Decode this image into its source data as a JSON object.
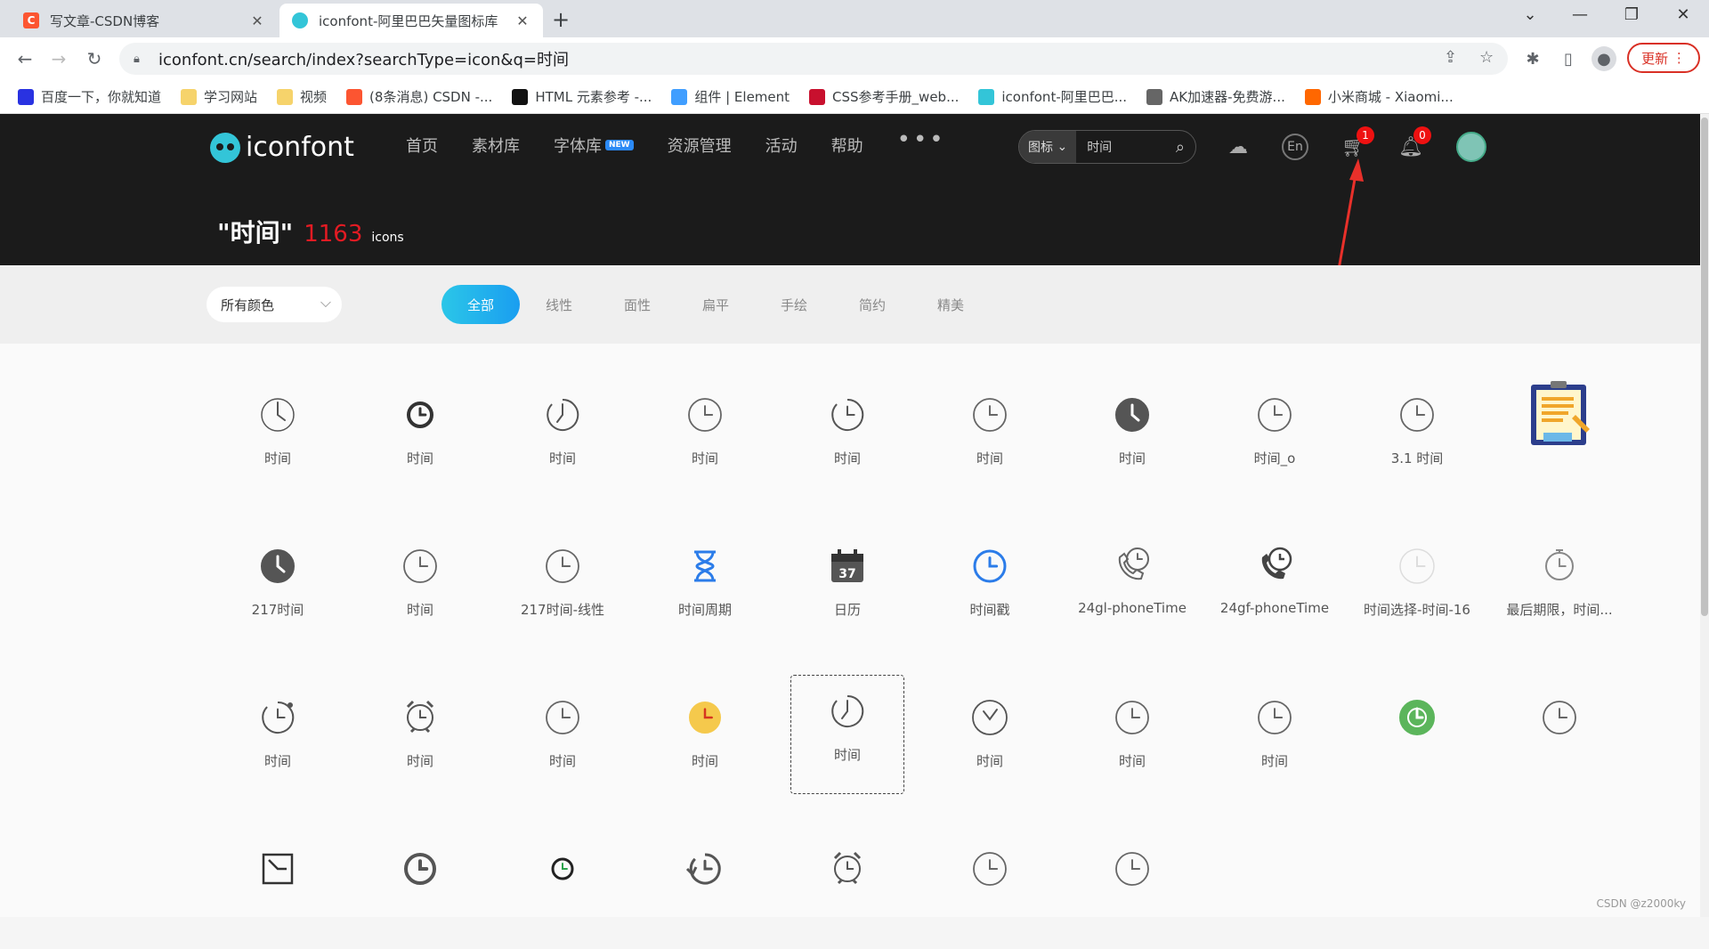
{
  "browser": {
    "tabs": [
      {
        "title": "写文章-CSDN博客",
        "fav": "C",
        "fav_color": "#fc5531"
      },
      {
        "title": "iconfont-阿里巴巴矢量图标库",
        "fav": "",
        "fav_color": "#33c5d8"
      }
    ],
    "url": "iconfont.cn/search/index?searchType=icon&q=时间",
    "update_label": "更新",
    "bookmarks": [
      {
        "label": "百度一下，你就知道",
        "icon": "paw-icon",
        "color": "#2932e1"
      },
      {
        "label": "学习网站",
        "icon": "folder-icon",
        "color": "#f6d36b"
      },
      {
        "label": "视频",
        "icon": "folder-icon",
        "color": "#f6d36b"
      },
      {
        "label": "(8条消息) CSDN -...",
        "icon": "csdn-icon",
        "color": "#fc5531"
      },
      {
        "label": "HTML 元素参考 -...",
        "icon": "mdn-icon",
        "color": "#111111"
      },
      {
        "label": "组件 | Element",
        "icon": "element-icon",
        "color": "#409eff"
      },
      {
        "label": "CSS参考手册_web...",
        "icon": "d-icon",
        "color": "#c8102e"
      },
      {
        "label": "iconfont-阿里巴巴...",
        "icon": "iconfont-icon",
        "color": "#33c5d8"
      },
      {
        "label": "AK加速器-免费游...",
        "icon": "ak-icon",
        "color": "#666666"
      },
      {
        "label": "小米商城 - Xiaomi...",
        "icon": "mi-icon",
        "color": "#ff6700"
      }
    ]
  },
  "site": {
    "logo_text": "iconfont",
    "nav": [
      "首页",
      "素材库",
      "字体库",
      "资源管理",
      "活动",
      "帮助"
    ],
    "nav_new_badge": "NEW",
    "search_type": "图标",
    "search_value": "时间",
    "cart_count": "1",
    "bell_count": "0",
    "lang_label": "En",
    "result_keyword": "\"时间\"",
    "result_count": "1163",
    "result_unit": "icons"
  },
  "filters": {
    "color_select": "所有颜色",
    "styles": [
      "全部",
      "线性",
      "面性",
      "扁平",
      "手绘",
      "简约",
      "精美"
    ],
    "active_style": "全部"
  },
  "icons": [
    {
      "label": "时间",
      "icon": "clock-outline-icon"
    },
    {
      "label": "时间",
      "icon": "clock-bold-icon"
    },
    {
      "label": "时间",
      "icon": "clock-open-icon"
    },
    {
      "label": "时间",
      "icon": "clock-thin-icon"
    },
    {
      "label": "时间",
      "icon": "clock-arrow-icon"
    },
    {
      "label": "时间",
      "icon": "clock-thin-icon"
    },
    {
      "label": "时间",
      "icon": "clock-filled-icon"
    },
    {
      "label": "时间_o",
      "icon": "clock-thin-icon"
    },
    {
      "label": "3.1 时间",
      "icon": "clock-thin-icon"
    },
    {
      "label": "",
      "icon": "notepad-illustration-icon"
    },
    {
      "label": "217时间",
      "icon": "clock-filled-icon"
    },
    {
      "label": "时间",
      "icon": "clock-thin-icon"
    },
    {
      "label": "217时间-线性",
      "icon": "clock-thin-icon"
    },
    {
      "label": "时间周期",
      "icon": "hourglass-icon"
    },
    {
      "label": "日历",
      "icon": "calendar-icon"
    },
    {
      "label": "时间戳",
      "icon": "clock-blue-icon"
    },
    {
      "label": "24gl-phoneTime",
      "icon": "phone-clock-icon"
    },
    {
      "label": "24gf-phoneTime",
      "icon": "phone-clock-filled-icon"
    },
    {
      "label": "时间选择-时间-16",
      "icon": "clock-light-icon"
    },
    {
      "label": "最后期限，时间...",
      "icon": "stopwatch-icon"
    },
    {
      "label": "时间",
      "icon": "clock-refresh-icon"
    },
    {
      "label": "时间",
      "icon": "alarm-clock-icon"
    },
    {
      "label": "时间",
      "icon": "clock-thin-icon"
    },
    {
      "label": "时间",
      "icon": "clock-yellow-icon"
    },
    {
      "label": "时间",
      "icon": "clock-open-icon"
    },
    {
      "label": "时间",
      "icon": "clock-v-icon"
    },
    {
      "label": "时间",
      "icon": "clock-thin-icon"
    },
    {
      "label": "时间",
      "icon": "clock-thin-icon"
    },
    {
      "label": "",
      "icon": "clock-green-icon"
    },
    {
      "label": "",
      "icon": "clock-thin-icon"
    },
    {
      "label": "",
      "icon": "square-clock-icon"
    },
    {
      "label": "",
      "icon": "clock-pie-icon"
    },
    {
      "label": "",
      "icon": "clock-small-bold-icon"
    },
    {
      "label": "",
      "icon": "clock-history-icon"
    },
    {
      "label": "",
      "icon": "alarm-clock-icon"
    },
    {
      "label": "",
      "icon": "clock-thin-icon"
    },
    {
      "label": "",
      "icon": "clock-thin-icon"
    }
  ],
  "watermark": "CSDN @z2000ky"
}
